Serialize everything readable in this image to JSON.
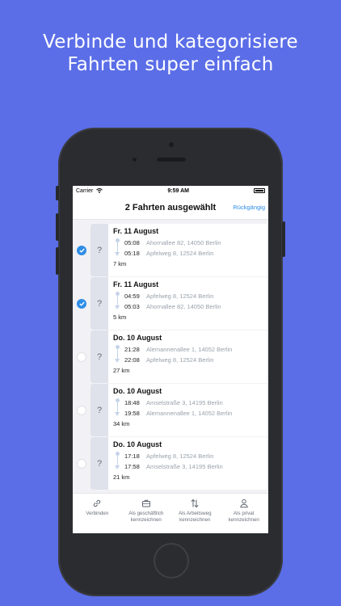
{
  "headline": {
    "line1": "Verbinde und kategorisiere",
    "line2": "Fahrten super einfach"
  },
  "statusbar": {
    "carrier": "Carrier",
    "time": "9:59 AM"
  },
  "navbar": {
    "title": "2 Fahrten ausgewählt",
    "undo": "Rückgängig"
  },
  "trips": [
    {
      "selected": true,
      "category": "?",
      "date": "Fr. 11 August",
      "stops": [
        {
          "time": "05:08",
          "address": "Ahornallee 82, 14050 Berlin"
        },
        {
          "time": "05:18",
          "address": "Apfelweg 8, 12524 Berlin"
        }
      ],
      "distance": "7 km"
    },
    {
      "selected": true,
      "category": "?",
      "date": "Fr. 11 August",
      "stops": [
        {
          "time": "04:59",
          "address": "Apfelweg 8, 12524 Berlin"
        },
        {
          "time": "05:03",
          "address": "Ahornallee 82, 14050 Berlin"
        }
      ],
      "distance": "5 km"
    },
    {
      "selected": false,
      "category": "?",
      "date": "Do. 10 August",
      "stops": [
        {
          "time": "21:28",
          "address": "Alemannenallee 1, 14052 Berlin"
        },
        {
          "time": "22:08",
          "address": "Apfelweg 8, 12524 Berlin"
        }
      ],
      "distance": "27 km"
    },
    {
      "selected": false,
      "category": "?",
      "date": "Do. 10 August",
      "stops": [
        {
          "time": "18:48",
          "address": "Amselstraße 3, 14195 Berlin"
        },
        {
          "time": "19:58",
          "address": "Alemannenallee 1, 14052 Berlin"
        }
      ],
      "distance": "34 km"
    },
    {
      "selected": false,
      "category": "?",
      "date": "Do. 10 August",
      "stops": [
        {
          "time": "17:18",
          "address": "Apfelweg 8, 12524 Berlin"
        },
        {
          "time": "17:58",
          "address": "Amselstraße 3, 14195 Berlin"
        }
      ],
      "distance": "21 km"
    }
  ],
  "toolbar": {
    "connect": {
      "label": "Verbinden",
      "icon": "link-icon"
    },
    "business": {
      "label": "Als geschäftlich\nkennzeichnen",
      "icon": "briefcase-icon"
    },
    "commute": {
      "label": "Als Arbeitsweg\nkennzeichnen",
      "icon": "arrows-up-down-icon"
    },
    "private": {
      "label": "Als privat\nkennzeichnen",
      "icon": "person-icon"
    }
  },
  "colors": {
    "background": "#5b6ee8",
    "accent": "#2f8de6",
    "phone": "#2b2c30"
  }
}
